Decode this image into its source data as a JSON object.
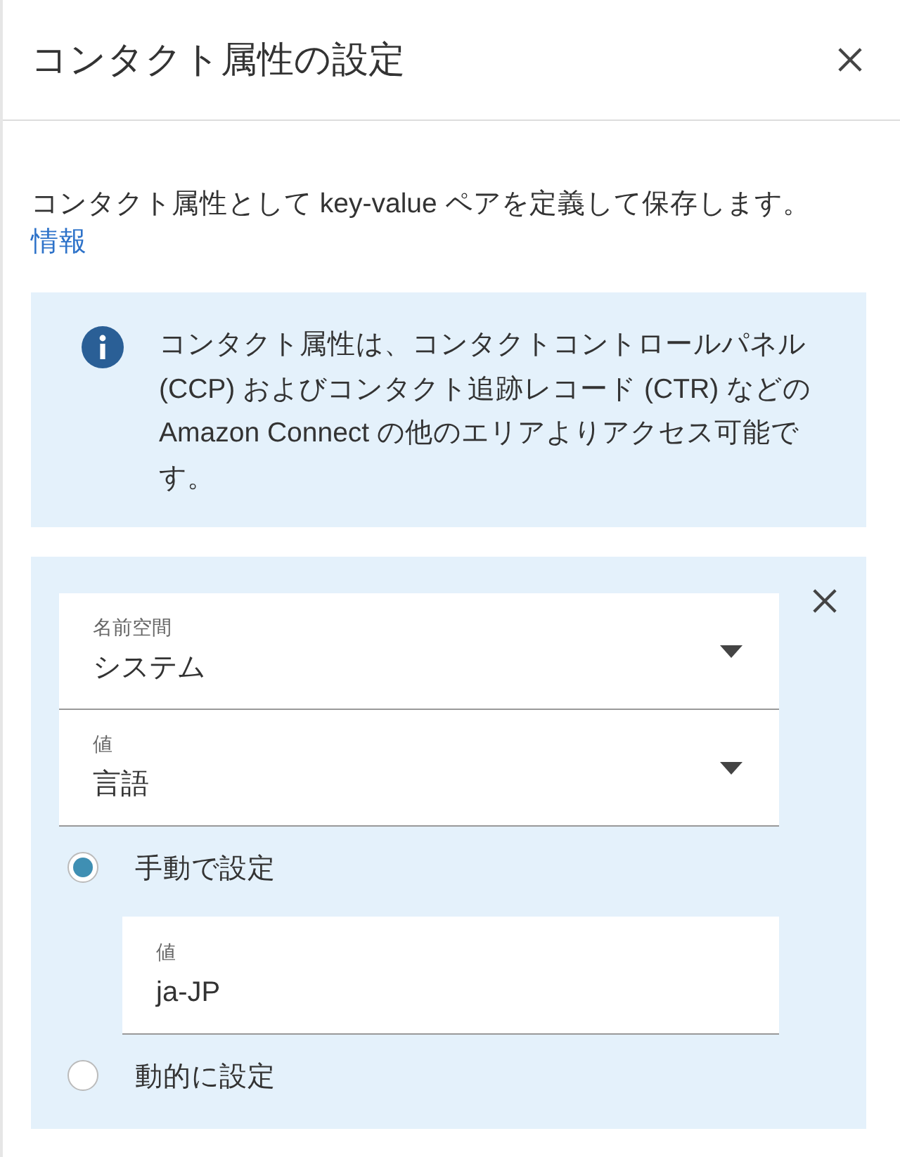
{
  "panel": {
    "title": "コンタクト属性の設定",
    "description": "コンタクト属性として key-value ペアを定義して保存します。",
    "info_link": "情報"
  },
  "info_alert": {
    "text": "コンタクト属性は、コンタクトコントロールパネル (CCP) およびコンタクト追跡レコード (CTR) などの Amazon Connect の他のエリアよりアクセス可能です。"
  },
  "attribute": {
    "fields": [
      {
        "kind": "select",
        "label": "名前空間",
        "value": "システム"
      },
      {
        "kind": "select",
        "label": "値",
        "value": "言語"
      }
    ],
    "options": [
      {
        "label": "手動で設定",
        "selected": true,
        "field": {
          "label": "値",
          "value": "ja-JP"
        }
      },
      {
        "label": "動的に設定",
        "selected": false
      }
    ]
  }
}
